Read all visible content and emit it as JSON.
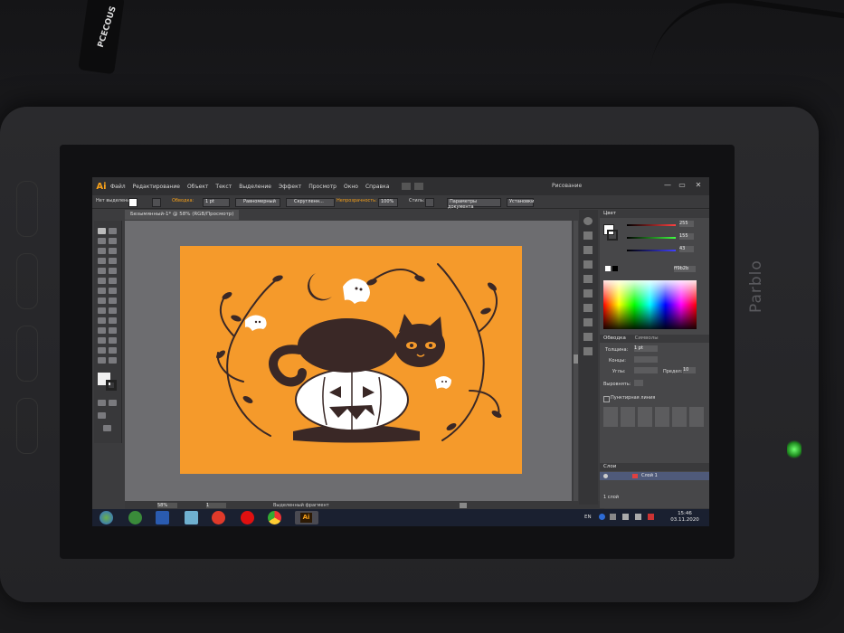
{
  "app": {
    "logo": "Ai",
    "menu": [
      "Файл",
      "Редактирование",
      "Объект",
      "Текст",
      "Выделение",
      "Эффект",
      "Просмотр",
      "Окно",
      "Справка"
    ],
    "workspace": "Рисование",
    "window_buttons": [
      "—",
      "▭",
      "✕"
    ]
  },
  "control_bar": {
    "selection_label": "Нет выделения",
    "stroke_label": "Обводка:",
    "stroke_weight": "1 pt",
    "profile": "Равномерный",
    "brush": "Скругленн...",
    "opacity_label": "Непрозрачность:",
    "opacity": "100%",
    "style_label": "Стиль:",
    "doc_settings": "Параметры документа",
    "prefs": "Установки"
  },
  "document_tab": "Безымянный-1* @ 58% (RGB/Просмотр)",
  "color_panel": {
    "title": "Цвет",
    "r": "255",
    "g": "155",
    "b": "43",
    "hex": "ff9b2b"
  },
  "stroke_panel": {
    "tabs": [
      "Обводка",
      "Символы"
    ],
    "weight_label": "Толщина:",
    "weight": "1 pt",
    "cap_label": "Концы:",
    "corner_label": "Углы:",
    "limit_label": "Предел:",
    "limit": "10",
    "align_label": "Выровнять:",
    "dashed_label": "Пунктирная линия"
  },
  "layers_panel": {
    "title": "Слои",
    "layer_name": "Слой 1",
    "footer": "1 слой"
  },
  "status": {
    "zoom": "58%",
    "page": "1",
    "tool": "Выделенный фрагмент"
  },
  "taskbar": {
    "lang": "EN",
    "time": "15:46",
    "date": "03.11.2020",
    "apps": [
      "start",
      "utorrent",
      "word",
      "files",
      "ok",
      "opera",
      "chrome",
      "illustrator"
    ]
  },
  "device": {
    "brand": "Parblo",
    "cable_label": "PCECOUS"
  },
  "colors": {
    "artboard": "#f59a2b",
    "ink": "#3a2826",
    "ghost": "#ffffff",
    "ui_dark": "#3c3c3e"
  }
}
